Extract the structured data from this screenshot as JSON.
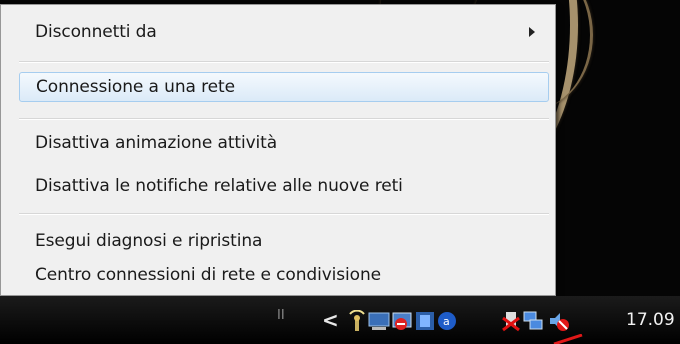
{
  "menu": {
    "items": [
      {
        "label": "Disconnetti da"
      },
      {
        "label": "Connessione a una rete"
      },
      {
        "label": "Disattiva animazione attività"
      },
      {
        "label": "Disattiva le notifiche relative alle nuove reti"
      },
      {
        "label": "Esegui diagnosi e ripristina"
      },
      {
        "label": "Centro connessioni di rete e condivisione"
      }
    ]
  },
  "taskbar": {
    "clock": "17.09",
    "icons": [
      "wireless-icon",
      "monitor-icon",
      "blocked-screen-icon",
      "shield-icon",
      "network-disconnected-icon",
      "network-icon",
      "volume-muted-icon"
    ]
  },
  "colors": {
    "menu_bg": "#f0f0f0",
    "hover_border": "#a6cdef",
    "taskbar_bg": "#000000"
  }
}
